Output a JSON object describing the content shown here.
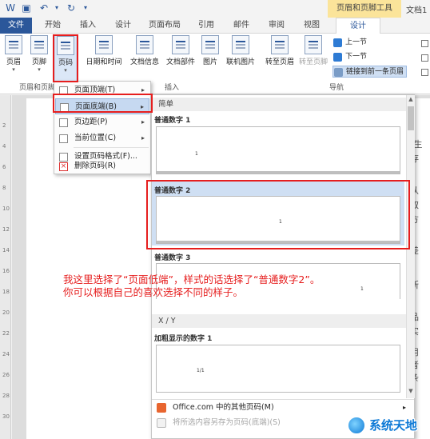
{
  "titlebar": {
    "contextual_title": "页眉和页脚工具",
    "doc_title": "文档1"
  },
  "tabs": [
    "文件",
    "开始",
    "插入",
    "设计",
    "页面布局",
    "引用",
    "邮件",
    "审阅",
    "视图",
    "设计"
  ],
  "ribbon": {
    "buttons": [
      "页眉",
      "页脚",
      "页码",
      "日期和时间",
      "文档信息",
      "文档部件",
      "图片",
      "联机图片",
      "转至页眉",
      "转至页脚"
    ],
    "nav": {
      "prev": "上一节",
      "next": "下一节",
      "link_prev": "链接到前一条页眉"
    },
    "groups": {
      "hf": "页眉和页脚",
      "insert": "插入",
      "nav": "导航"
    }
  },
  "page_number_menu": [
    {
      "label": "页面顶端(T)",
      "sub": "▸"
    },
    {
      "label": "页面底端(B)",
      "sub": "▸"
    },
    {
      "label": "页边距(P)",
      "sub": "▸"
    },
    {
      "label": "当前位置(C)",
      "sub": "▸"
    },
    {
      "label": "设置页码格式(F)..."
    },
    {
      "label": "删除页码(R)"
    }
  ],
  "gallery": {
    "section_simple": "简单",
    "item1": "普通数字 1",
    "item2": "普通数字 2",
    "item3": "普通数字 3",
    "section_xy": "X / Y",
    "item4": "加粗显示的数字 1",
    "preview_num": "1",
    "preview_xy": "1/1",
    "footer_more": "Office.com 中的其他页码(M)",
    "footer_more_arrow": "▸",
    "footer_save": "将所选内容另存为页码(底端)(S)"
  },
  "doc_fragments": [
    "C",
    "r产生",
    "析存",
    "是从",
    "段取",
    "一方",
    "等差",
    "中所",
    "商品",
    "律实",
    "作用",
    "产者",
    "化条"
  ],
  "annotation": "我这里选择了“页面低端”，样式的话选择了“普通数字2”。\n你可以根据自己的喜欢选择不同的样子。",
  "watermark": "系统天地",
  "ruler_numbers": [
    "2",
    "4",
    "6",
    "8",
    "10",
    "12",
    "14",
    "16",
    "18",
    "20",
    "22",
    "24",
    "26",
    "28",
    "30"
  ],
  "colors": {
    "accent": "#2b579a",
    "highlight_red": "#e61e1e",
    "contextual": "#fbe49a",
    "selection": "#c6d9f1"
  }
}
